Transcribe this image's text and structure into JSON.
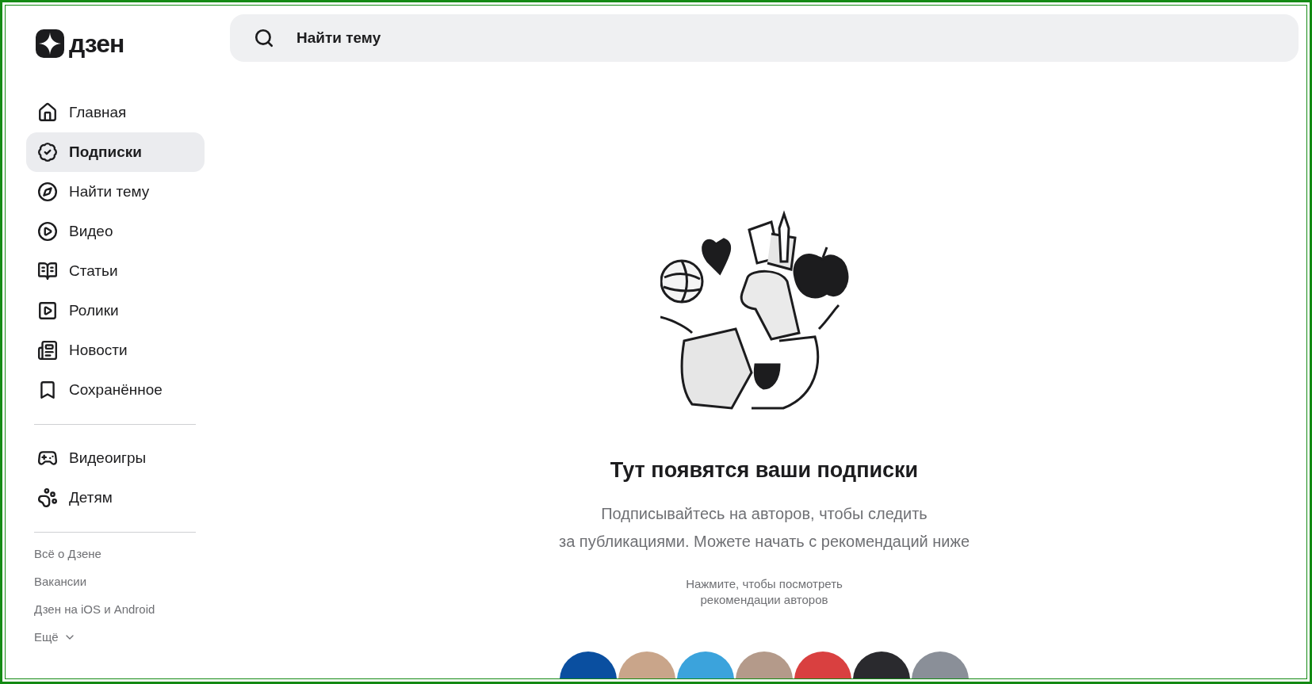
{
  "logo": {
    "text": "дзен"
  },
  "search": {
    "placeholder": "Найти тему"
  },
  "sidebar": {
    "groups": [
      {
        "items": [
          {
            "label": "Главная",
            "selected": false
          },
          {
            "label": "Подписки",
            "selected": true
          },
          {
            "label": "Найти тему",
            "selected": false
          },
          {
            "label": "Видео",
            "selected": false
          },
          {
            "label": "Статьи",
            "selected": false
          },
          {
            "label": "Ролики",
            "selected": false
          },
          {
            "label": "Новости",
            "selected": false
          },
          {
            "label": "Сохранённое",
            "selected": false
          }
        ]
      },
      {
        "items": [
          {
            "label": "Видеоигры",
            "selected": false
          },
          {
            "label": "Детям",
            "selected": false
          }
        ]
      }
    ],
    "links": [
      "Всё о Дзене",
      "Вакансии",
      "Дзен на iOS и Android"
    ],
    "more": "Ещё"
  },
  "empty_state": {
    "title": "Тут появятся ваши подписки",
    "lines": [
      "Подписывайтесь на авторов, чтобы следить",
      "за публикациями. Можете начать с рекомендаций ниже"
    ],
    "hint": [
      "Нажмите, чтобы посмотреть",
      "рекомендации авторов"
    ]
  }
}
